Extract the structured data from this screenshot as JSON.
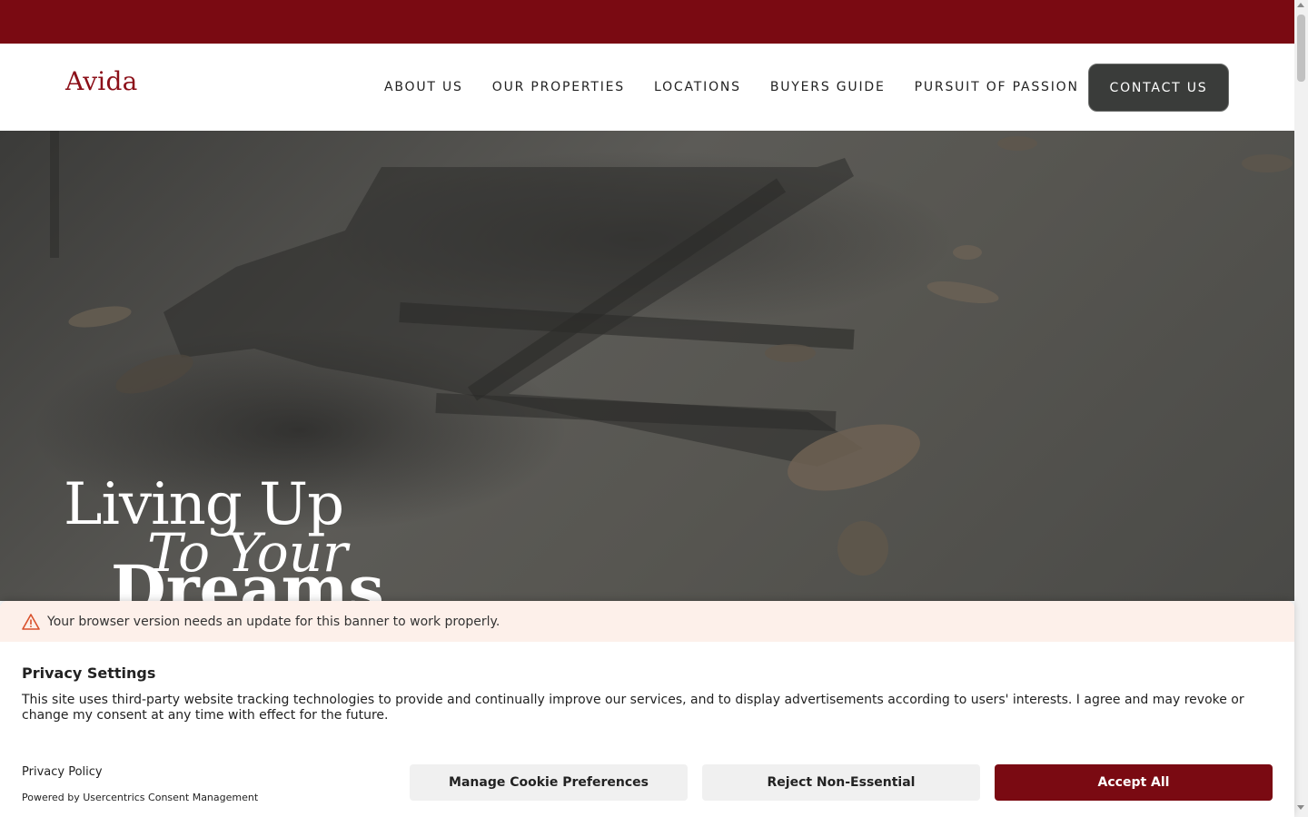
{
  "colors": {
    "brand": "#7a0a12",
    "contact_bg": "#3a3c3a",
    "warning_bg": "#fdf0ea"
  },
  "header": {
    "logo": "Avida",
    "nav": [
      "ABOUT US",
      "OUR PROPERTIES",
      "LOCATIONS",
      "BUYERS GUIDE",
      "PURSUIT OF PASSION"
    ],
    "contact_label": "CONTACT US"
  },
  "hero": {
    "line1": "Living Up",
    "line2": "To Your",
    "line3": "Dreams"
  },
  "cookie": {
    "warning": "Your browser version needs an update for this banner to work properly.",
    "title": "Privacy Settings",
    "description": "This site uses third-party website tracking technologies to provide and continually improve our services, and to display advertisements according to users' interests. I agree and may revoke or change my consent at any time with effect for the future.",
    "privacy_link": "Privacy Policy",
    "powered_by": "Powered by Usercentrics Consent Management",
    "manage_label": "Manage Cookie Preferences",
    "reject_label": "Reject Non-Essential",
    "accept_label": "Accept All"
  }
}
